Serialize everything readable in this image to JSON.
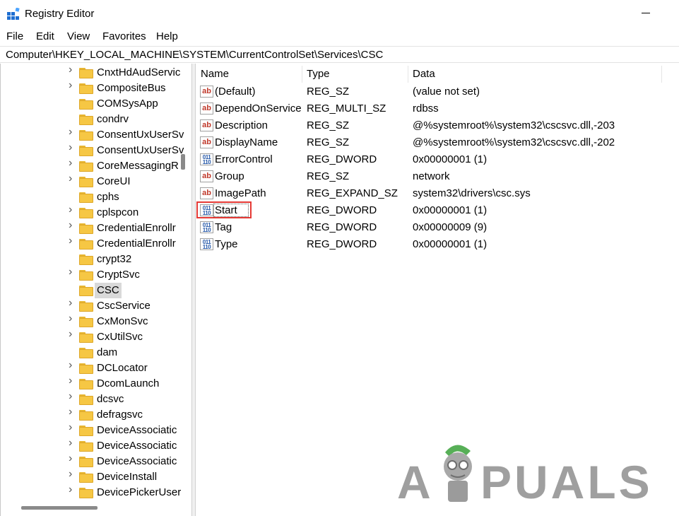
{
  "window": {
    "title": "Registry Editor"
  },
  "menu": [
    "File",
    "Edit",
    "View",
    "Favorites",
    "Help"
  ],
  "address": "Computer\\HKEY_LOCAL_MACHINE\\SYSTEM\\CurrentControlSet\\Services\\CSC",
  "tree": {
    "items": [
      {
        "label": "CnxtHdAudServic",
        "expandable": true
      },
      {
        "label": "CompositeBus",
        "expandable": true
      },
      {
        "label": "COMSysApp",
        "expandable": false
      },
      {
        "label": "condrv",
        "expandable": false
      },
      {
        "label": "ConsentUxUserSv",
        "expandable": true
      },
      {
        "label": "ConsentUxUserSv",
        "expandable": true
      },
      {
        "label": "CoreMessagingR",
        "expandable": true
      },
      {
        "label": "CoreUI",
        "expandable": true
      },
      {
        "label": "cphs",
        "expandable": false
      },
      {
        "label": "cplspcon",
        "expandable": true
      },
      {
        "label": "CredentialEnrollr",
        "expandable": true
      },
      {
        "label": "CredentialEnrollr",
        "expandable": true
      },
      {
        "label": "crypt32",
        "expandable": false
      },
      {
        "label": "CryptSvc",
        "expandable": true
      },
      {
        "label": "CSC",
        "expandable": false,
        "selected": true
      },
      {
        "label": "CscService",
        "expandable": true
      },
      {
        "label": "CxMonSvc",
        "expandable": true
      },
      {
        "label": "CxUtilSvc",
        "expandable": true
      },
      {
        "label": "dam",
        "expandable": false
      },
      {
        "label": "DCLocator",
        "expandable": true
      },
      {
        "label": "DcomLaunch",
        "expandable": true
      },
      {
        "label": "dcsvc",
        "expandable": true
      },
      {
        "label": "defragsvc",
        "expandable": true
      },
      {
        "label": "DeviceAssociatic",
        "expandable": true
      },
      {
        "label": "DeviceAssociatic",
        "expandable": true
      },
      {
        "label": "DeviceAssociatic",
        "expandable": true
      },
      {
        "label": "DeviceInstall",
        "expandable": true
      },
      {
        "label": "DevicePickerUser",
        "expandable": true
      }
    ]
  },
  "columns": {
    "name": "Name",
    "type": "Type",
    "data": "Data"
  },
  "values": [
    {
      "icon": "string-value-icon",
      "name": "(Default)",
      "type": "REG_SZ",
      "data": "(value not set)"
    },
    {
      "icon": "string-value-icon",
      "name": "DependOnService",
      "type": "REG_MULTI_SZ",
      "data": "rdbss"
    },
    {
      "icon": "string-value-icon",
      "name": "Description",
      "type": "REG_SZ",
      "data": "@%systemroot%\\system32\\cscsvc.dll,-203"
    },
    {
      "icon": "string-value-icon",
      "name": "DisplayName",
      "type": "REG_SZ",
      "data": "@%systemroot%\\system32\\cscsvc.dll,-202"
    },
    {
      "icon": "binary-value-icon",
      "name": "ErrorControl",
      "type": "REG_DWORD",
      "data": "0x00000001 (1)"
    },
    {
      "icon": "string-value-icon",
      "name": "Group",
      "type": "REG_SZ",
      "data": "network"
    },
    {
      "icon": "string-value-icon",
      "name": "ImagePath",
      "type": "REG_EXPAND_SZ",
      "data": "system32\\drivers\\csc.sys"
    },
    {
      "icon": "binary-value-icon",
      "name": "Start",
      "type": "REG_DWORD",
      "data": "0x00000001 (1)",
      "highlighted": true
    },
    {
      "icon": "binary-value-icon",
      "name": "Tag",
      "type": "REG_DWORD",
      "data": "0x00000009 (9)"
    },
    {
      "icon": "binary-value-icon",
      "name": "Type",
      "type": "REG_DWORD",
      "data": "0x00000001 (1)"
    }
  ],
  "watermark": {
    "first": "A",
    "rest": "PUALS"
  },
  "colors": {
    "highlight": "#e53935",
    "folder": "#f6c744",
    "selection": "#d9d9d9"
  }
}
